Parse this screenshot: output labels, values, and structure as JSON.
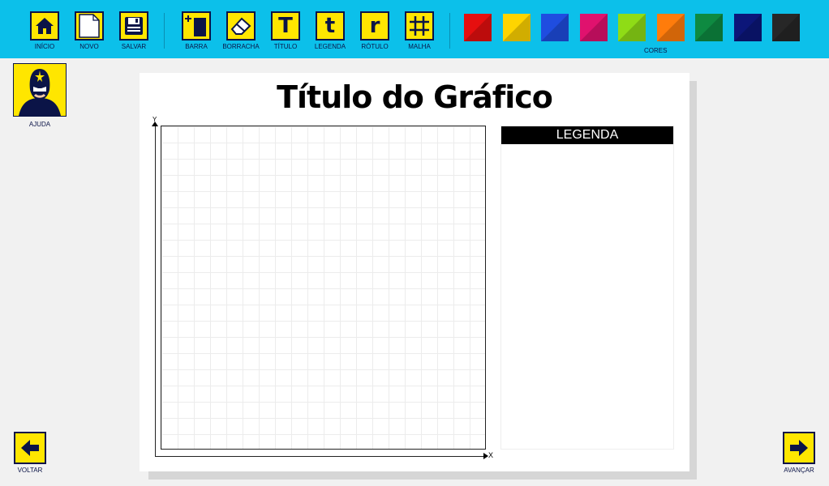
{
  "toolbar": {
    "inicio_label": "INÍCIO",
    "novo_label": "NOVO",
    "salvar_label": "SALVAR",
    "barra_label": "BARRA",
    "borracha_label": "BORRACHA",
    "titulo_label": "TÍTULO",
    "legenda_label": "LEGENDA",
    "rotulo_label": "RÓTULO",
    "malha_label": "MALHA",
    "titulo_glyph": "T",
    "legenda_glyph": "t",
    "rotulo_glyph": "r",
    "cores_label": "CORES"
  },
  "colors": [
    "#e60f0f",
    "#ffd400",
    "#1f4de0",
    "#e0126e",
    "#8fdc16",
    "#ff7c0b",
    "#0e8a41",
    "#0c1679",
    "#272727"
  ],
  "helper": {
    "label": "AJUDA"
  },
  "chart": {
    "title": "Título do Gráfico",
    "y_axis_label": "Y",
    "x_axis_label": "X",
    "legend_header": "LEGENDA"
  },
  "nav": {
    "back_label": "VOLTAR",
    "forward_label": "AVANÇAR"
  }
}
